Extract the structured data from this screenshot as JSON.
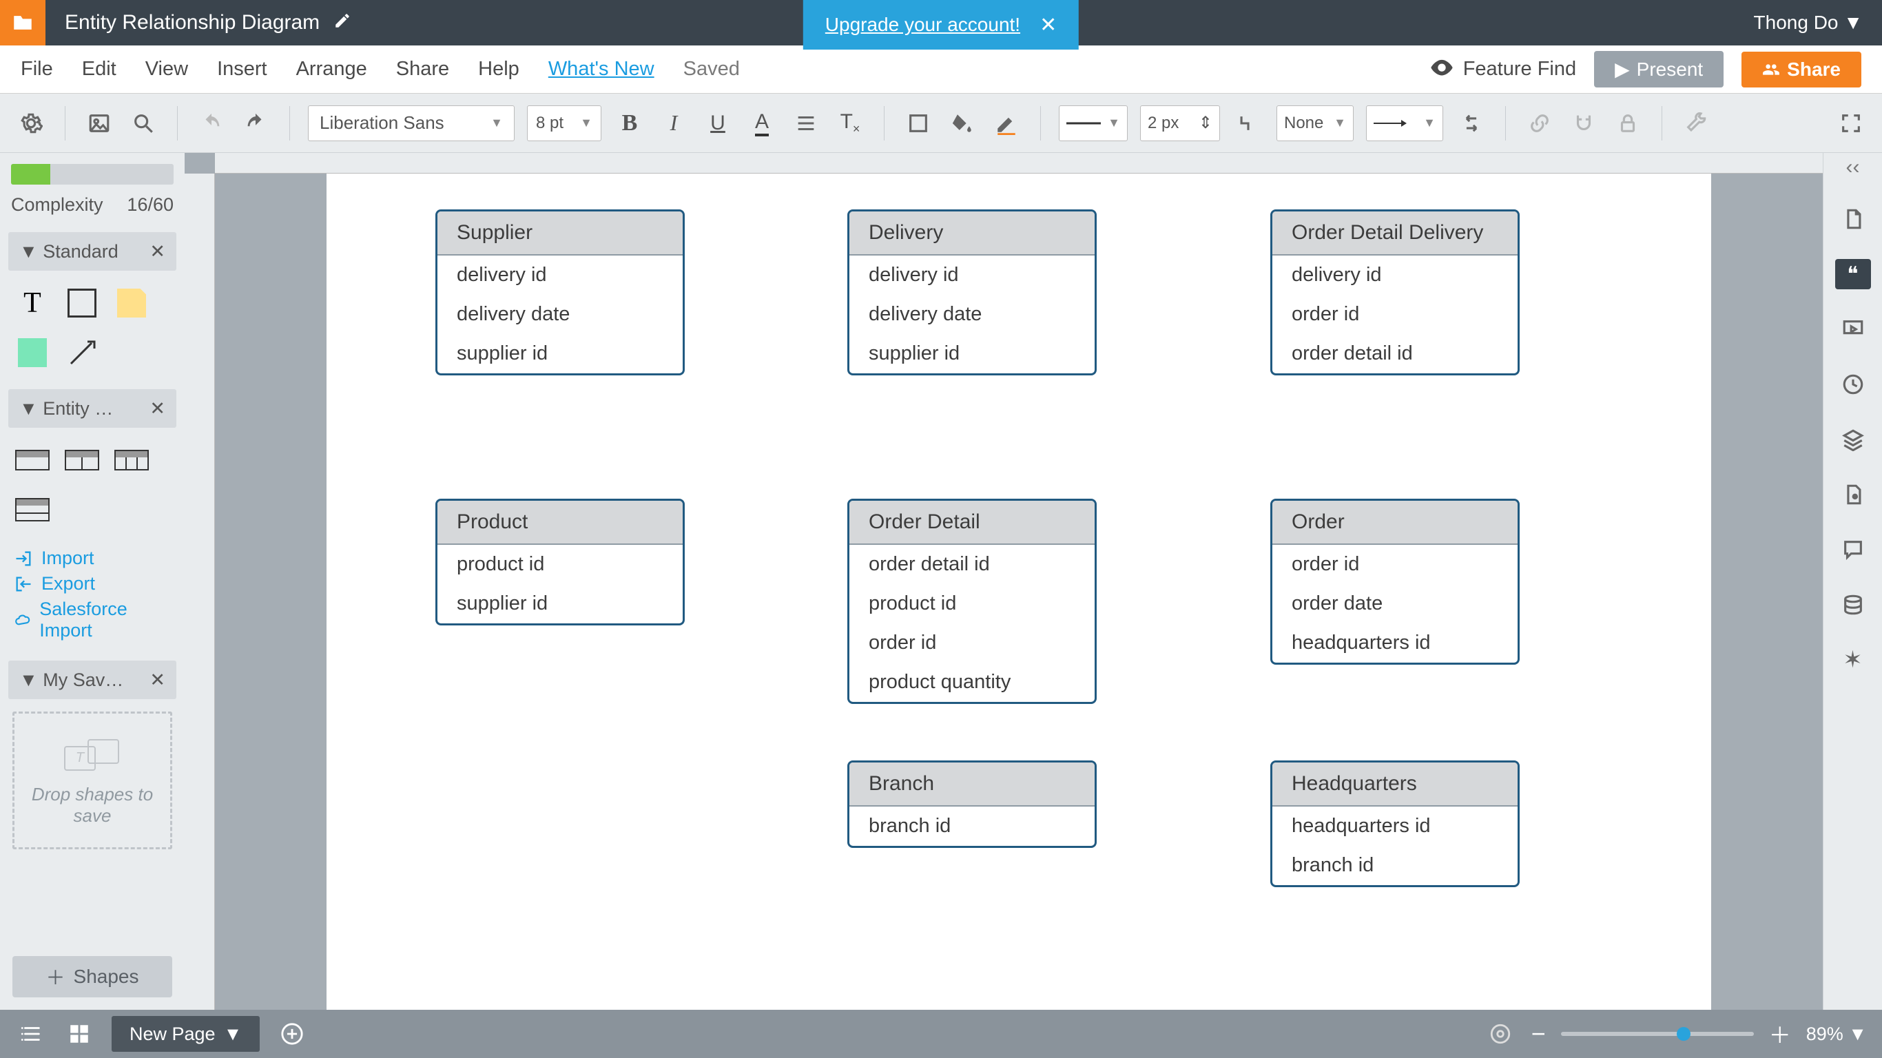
{
  "header": {
    "doc_title": "Entity Relationship Diagram",
    "upgrade_text": "Upgrade your account!",
    "user_name": "Thong Do"
  },
  "menubar": {
    "items": [
      "File",
      "Edit",
      "View",
      "Insert",
      "Arrange",
      "Share",
      "Help"
    ],
    "whats_new": "What's New",
    "saved": "Saved",
    "feature_find": "Feature Find",
    "present": "Present",
    "share": "Share"
  },
  "toolbar": {
    "font": "Liberation Sans",
    "font_size": "8 pt",
    "line_width": "2 px",
    "line_endpoint_left": "None"
  },
  "leftpanel": {
    "complexity_label": "Complexity",
    "complexity_value": "16/60",
    "shelf_standard": "Standard",
    "shelf_entity": "Entity …",
    "shelf_saved": "My Sav…",
    "import": "Import",
    "export": "Export",
    "salesforce": "Salesforce Import",
    "drop_hint": "Drop shapes to save",
    "shapes_btn": "Shapes"
  },
  "entities": {
    "supplier": {
      "title": "Supplier",
      "rows": [
        "delivery id",
        "delivery date",
        "supplier id"
      ]
    },
    "delivery": {
      "title": "Delivery",
      "rows": [
        "delivery id",
        "delivery date",
        "supplier id"
      ]
    },
    "odd": {
      "title": "Order Detail Delivery",
      "rows": [
        "delivery id",
        "order id",
        "order detail id"
      ]
    },
    "product": {
      "title": "Product",
      "rows": [
        "product id",
        "supplier id"
      ]
    },
    "orderdetail": {
      "title": "Order Detail",
      "rows": [
        "order detail id",
        "product id",
        "order id",
        "product quantity"
      ]
    },
    "order": {
      "title": "Order",
      "rows": [
        "order id",
        "order date",
        "headquarters id"
      ]
    },
    "branch": {
      "title": "Branch",
      "rows": [
        "branch id"
      ]
    },
    "hq": {
      "title": "Headquarters",
      "rows": [
        "headquarters id",
        "branch id"
      ]
    }
  },
  "bottombar": {
    "page_tab": "New Page",
    "zoom": "89%"
  }
}
